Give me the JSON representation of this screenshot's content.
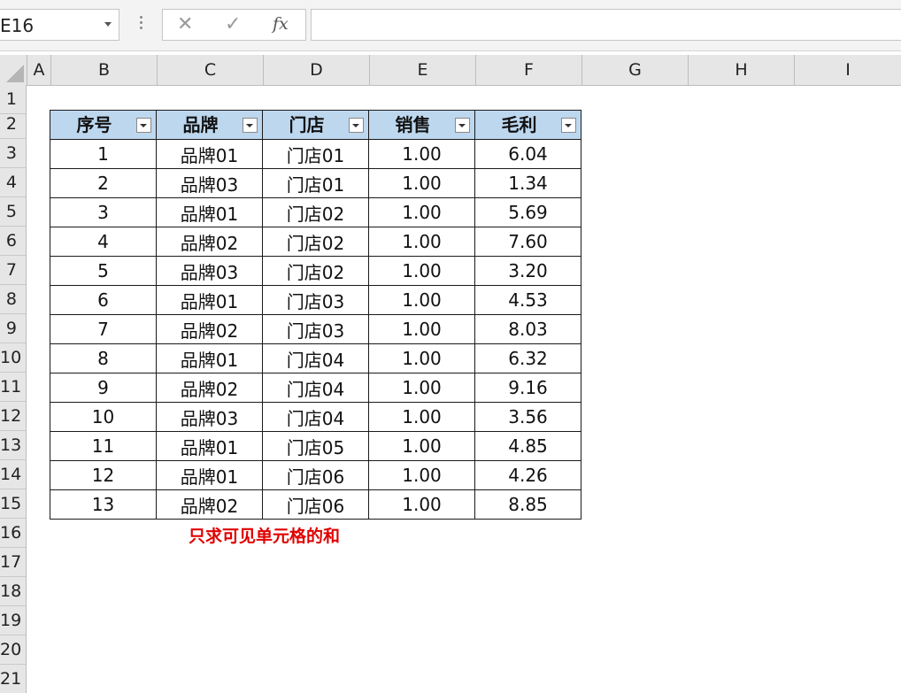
{
  "name_box": {
    "value": "E16"
  },
  "formula_bar": {
    "cancel_icon": "✕",
    "enter_icon": "✓",
    "fx_label": "fx",
    "value": ""
  },
  "columns": [
    "A",
    "B",
    "C",
    "D",
    "E",
    "F",
    "G",
    "H",
    "I"
  ],
  "rows": [
    "1",
    "2",
    "3",
    "4",
    "5",
    "6",
    "7",
    "8",
    "9",
    "10",
    "11",
    "12",
    "13",
    "14",
    "15",
    "16",
    "17",
    "18",
    "19",
    "20",
    "21"
  ],
  "table": {
    "headers": [
      "序号",
      "品牌",
      "门店",
      "销售",
      "毛利"
    ],
    "rows": [
      [
        "1",
        "品牌01",
        "门店01",
        "1.00",
        "6.04"
      ],
      [
        "2",
        "品牌03",
        "门店01",
        "1.00",
        "1.34"
      ],
      [
        "3",
        "品牌01",
        "门店02",
        "1.00",
        "5.69"
      ],
      [
        "4",
        "品牌02",
        "门店02",
        "1.00",
        "7.60"
      ],
      [
        "5",
        "品牌03",
        "门店02",
        "1.00",
        "3.20"
      ],
      [
        "6",
        "品牌01",
        "门店03",
        "1.00",
        "4.53"
      ],
      [
        "7",
        "品牌02",
        "门店03",
        "1.00",
        "8.03"
      ],
      [
        "8",
        "品牌01",
        "门店04",
        "1.00",
        "6.32"
      ],
      [
        "9",
        "品牌02",
        "门店04",
        "1.00",
        "9.16"
      ],
      [
        "10",
        "品牌03",
        "门店04",
        "1.00",
        "3.56"
      ],
      [
        "11",
        "品牌01",
        "门店05",
        "1.00",
        "4.85"
      ],
      [
        "12",
        "品牌01",
        "门店06",
        "1.00",
        "4.26"
      ],
      [
        "13",
        "品牌02",
        "门店06",
        "1.00",
        "8.85"
      ]
    ]
  },
  "note": "只求可见单元格的和",
  "colors": {
    "header_fill": "#bdd7ee",
    "note_color": "#e00000"
  }
}
